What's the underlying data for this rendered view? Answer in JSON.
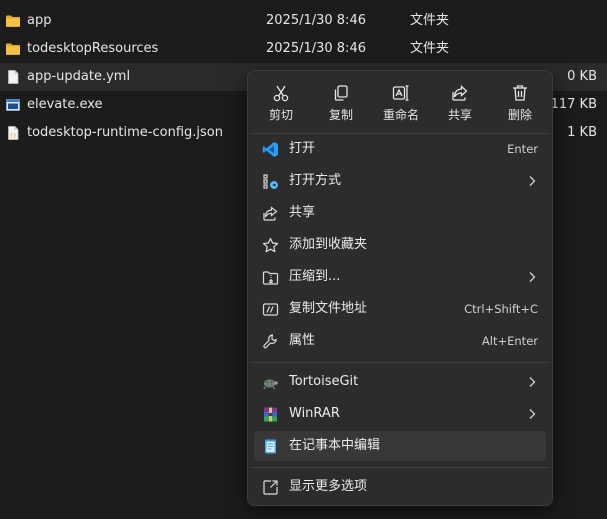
{
  "files": [
    {
      "name": "app",
      "date": "2025/1/30 8:46",
      "type": "文件夹",
      "size": "",
      "icon": "folder-icon"
    },
    {
      "name": "todesktopResources",
      "date": "2025/1/30 8:46",
      "type": "文件夹",
      "size": "",
      "icon": "folder-icon"
    },
    {
      "name": "app-update.yml",
      "date": "",
      "type": "",
      "size": "0 KB",
      "icon": "yml-file-icon"
    },
    {
      "name": "elevate.exe",
      "date": "",
      "type": "",
      "size": "117 KB",
      "icon": "exe-file-icon"
    },
    {
      "name": "todesktop-runtime-config.json",
      "date": "",
      "type": "",
      "size": "1 KB",
      "icon": "json-file-icon"
    }
  ],
  "context_menu": {
    "quick_actions": [
      {
        "label": "剪切",
        "icon": "cut-icon"
      },
      {
        "label": "复制",
        "icon": "copy-icon"
      },
      {
        "label": "重命名",
        "icon": "rename-icon"
      },
      {
        "label": "共享",
        "icon": "share-icon"
      },
      {
        "label": "删除",
        "icon": "delete-icon"
      }
    ],
    "items": [
      {
        "label": "打开",
        "shortcut": "Enter",
        "icon": "vscode-icon"
      },
      {
        "label": "打开方式",
        "shortcut": "",
        "icon": "open-with-icon"
      },
      {
        "label": "共享",
        "shortcut": "",
        "icon": "share-icon"
      },
      {
        "label": "添加到收藏夹",
        "shortcut": "",
        "icon": "star-icon"
      },
      {
        "label": "压缩到...",
        "shortcut": "",
        "icon": "compress-icon"
      },
      {
        "label": "复制文件地址",
        "shortcut": "Ctrl+Shift+C",
        "icon": "copy-path-icon"
      },
      {
        "label": "属性",
        "shortcut": "Alt+Enter",
        "icon": "properties-icon"
      },
      {
        "label": "TortoiseGit",
        "shortcut": "",
        "icon": "tortoisegit-icon"
      },
      {
        "label": "WinRAR",
        "shortcut": "",
        "icon": "winrar-icon"
      },
      {
        "label": "在记事本中编辑",
        "shortcut": "",
        "icon": "notepad-icon"
      },
      {
        "label": "显示更多选项",
        "shortcut": "",
        "icon": "more-options-icon"
      }
    ]
  },
  "colors": {
    "background": "#1c1c1c",
    "menu_background": "#2c2c2c",
    "accent": "#4cc2ff",
    "folder": "#f5c343"
  }
}
